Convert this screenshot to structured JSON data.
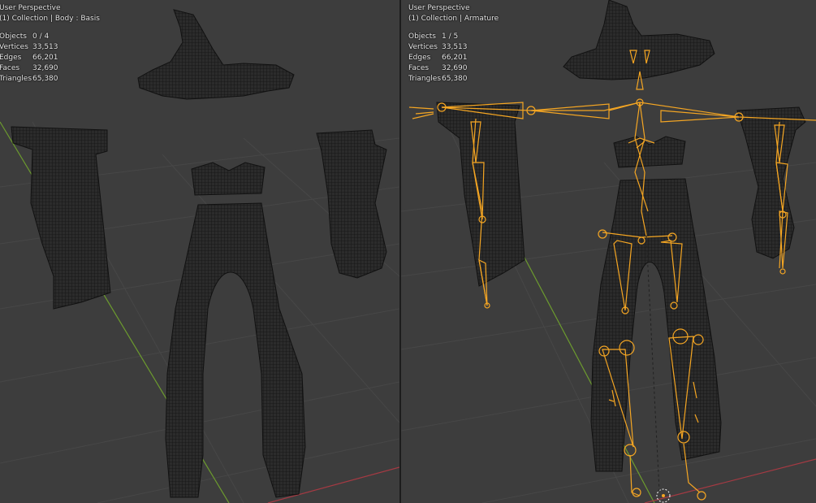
{
  "viewports": [
    {
      "perspective": "User Perspective",
      "context": "(1) Collection | Body : Basis",
      "stats": [
        {
          "label": "Objects",
          "value": "0 / 4"
        },
        {
          "label": "Vertices",
          "value": "33,513"
        },
        {
          "label": "Edges",
          "value": "66,201"
        },
        {
          "label": "Faces",
          "value": "32,690"
        },
        {
          "label": "Triangles",
          "value": "65,380"
        }
      ]
    },
    {
      "perspective": "User Perspective",
      "context": "(1) Collection | Armature",
      "stats": [
        {
          "label": "Objects",
          "value": "1 / 5"
        },
        {
          "label": "Vertices",
          "value": "33,513"
        },
        {
          "label": "Edges",
          "value": "66,201"
        },
        {
          "label": "Faces",
          "value": "32,690"
        },
        {
          "label": "Triangles",
          "value": "65,380"
        }
      ]
    }
  ],
  "colors": {
    "background": "#3d3d3d",
    "grid": "#494949",
    "mesh_fill": "#2b2b2b",
    "mesh_wire": "#111111",
    "bone": "#f5a623",
    "axis_x": "#a53a43",
    "axis_y": "#6c9b2e"
  }
}
